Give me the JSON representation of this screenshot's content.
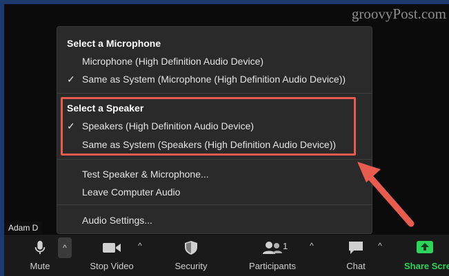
{
  "watermark": "groovyPost.com",
  "menu": {
    "microphone_heading": "Select a Microphone",
    "microphone_items": [
      {
        "label": "Microphone (High Definition Audio Device)",
        "checked": false
      },
      {
        "label": "Same as System (Microphone (High Definition Audio Device))",
        "checked": true
      }
    ],
    "speaker_heading": "Select a Speaker",
    "speaker_items": [
      {
        "label": "Speakers (High Definition Audio Device)",
        "checked": true
      },
      {
        "label": "Same as System (Speakers (High Definition Audio Device))",
        "checked": false
      }
    ],
    "actions": [
      "Test Speaker & Microphone...",
      "Leave Computer Audio"
    ],
    "settings": "Audio Settings...",
    "check_glyph": "✓"
  },
  "participant_name": "Adam D",
  "toolbar": {
    "mute": "Mute",
    "stop_video": "Stop Video",
    "security": "Security",
    "participants": "Participants",
    "participants_count": "1",
    "chat": "Chat",
    "share": "Share Screen",
    "caret": "^"
  },
  "colors": {
    "highlight": "#e95b4f",
    "share_green": "#2bd45a",
    "menu_bg": "#2a2a2a"
  }
}
